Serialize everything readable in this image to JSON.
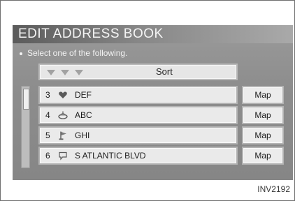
{
  "screen": {
    "title": "EDIT ADDRESS BOOK",
    "instruction": "Select one of the following.",
    "sort_label": "Sort",
    "rows": [
      {
        "number": "3",
        "icon": "heart-icon",
        "name": "DEF",
        "map_label": "Map"
      },
      {
        "number": "4",
        "icon": "food-icon",
        "name": "ABC",
        "map_label": "Map"
      },
      {
        "number": "5",
        "icon": "flag-icon",
        "name": "GHI",
        "map_label": "Map"
      },
      {
        "number": "6",
        "icon": "speech-bubble-icon",
        "name": "S ATLANTIC BLVD",
        "map_label": "Map"
      }
    ]
  },
  "caption": "INV2192"
}
